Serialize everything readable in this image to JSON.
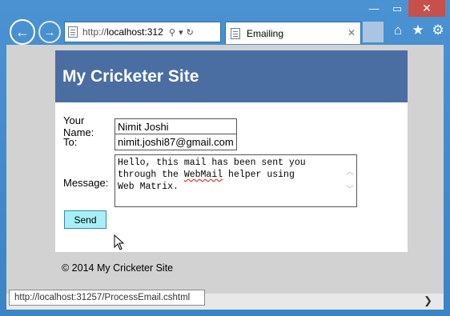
{
  "window": {
    "min": "—",
    "max": "▭",
    "close": "✕"
  },
  "nav": {
    "back": "←",
    "forward": "→"
  },
  "address": {
    "prefix": "http://",
    "host": "localhost:312",
    "search_icon": "⚲",
    "dropdown_icon": "▾",
    "refresh_icon": "↻"
  },
  "tab": {
    "title": "Emailing",
    "close": "✕"
  },
  "toolbar": {
    "home": "⌂",
    "favorites": "★",
    "settings": "⚙"
  },
  "site": {
    "title": "My Cricketer Site",
    "footer": "© 2014 My Cricketer Site"
  },
  "form": {
    "name_label": "Your Name:",
    "name_value": "Nimit Joshi",
    "to_label": "To:",
    "to_value": "nimit.joshi87@gmail.com",
    "message_label": "Message:",
    "message_part1": "Hello, this mail has been sent you\nthrough the ",
    "message_part2": "WebMail",
    "message_part3": " helper using\nWeb Matrix.",
    "send_label": "Send"
  },
  "scroll": {
    "up": "︿",
    "down": "﹀",
    "right": "❯"
  },
  "status": {
    "url": "http://localhost:31257/ProcessEmail.cshtml"
  }
}
